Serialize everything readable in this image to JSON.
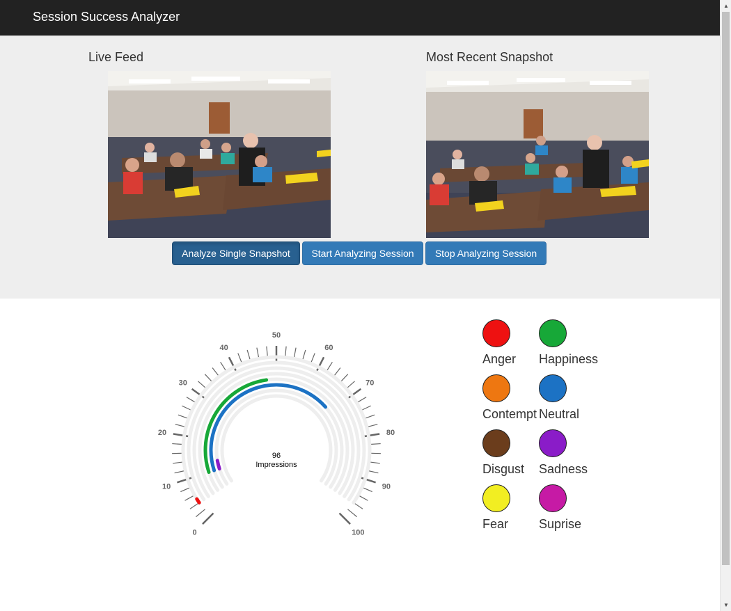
{
  "navbar": {
    "brand": "Session Success Analyzer"
  },
  "live_feed": {
    "title": "Live Feed"
  },
  "snapshot": {
    "title": "Most Recent Snapshot"
  },
  "buttons": {
    "analyze_single": "Analyze Single Snapshot",
    "start_session": "Start Analyzing Session",
    "stop_session": "Stop Analyzing Session"
  },
  "gauge": {
    "value": "96",
    "label": "Impressions",
    "ticks": [
      "0",
      "10",
      "20",
      "30",
      "40",
      "50",
      "60",
      "70",
      "80",
      "90",
      "100"
    ],
    "track_color": "#eeeeee",
    "series": [
      {
        "emotion": "Anger",
        "color": "#ee1111",
        "value": 1
      },
      {
        "emotion": "Happiness",
        "color": "#17a838",
        "value": 37
      },
      {
        "emotion": "Neutral",
        "color": "#1c72c4",
        "value": 58
      },
      {
        "emotion": "Sadness",
        "color": "#8a1cc8",
        "value": 3
      }
    ]
  },
  "legend": [
    {
      "label": "Anger",
      "color": "#ee1111"
    },
    {
      "label": "Happiness",
      "color": "#17a838"
    },
    {
      "label": "Contempt",
      "color": "#ee7711"
    },
    {
      "label": "Neutral",
      "color": "#1c72c4"
    },
    {
      "label": "Disgust",
      "color": "#6b3d1c"
    },
    {
      "label": "Sadness",
      "color": "#8a1cc8"
    },
    {
      "label": "Fear",
      "color": "#f2ee22"
    },
    {
      "label": "Suprise",
      "color": "#c61aa5"
    }
  ]
}
